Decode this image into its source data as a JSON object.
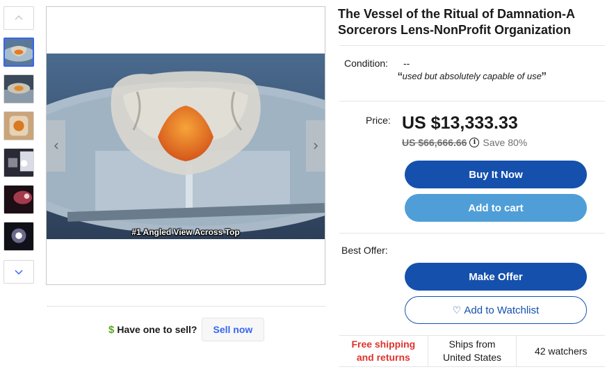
{
  "title": "The Vessel of the Ritual of Damnation-A Sorcerors Lens-NonProfit Organization",
  "gallery": {
    "caption": "#1 Angled View Across Top",
    "thumbnails": [
      "thumb-1",
      "thumb-2",
      "thumb-3",
      "thumb-4",
      "thumb-5",
      "thumb-6"
    ],
    "active_index": 0,
    "icons": {
      "up": "chevron-up-icon",
      "down": "chevron-down-icon",
      "prev": "chevron-left-icon",
      "next": "chevron-right-icon"
    }
  },
  "sell": {
    "icon": "dollar-icon",
    "icon_glyph": "$",
    "text": "Have one to sell?",
    "button": "Sell now"
  },
  "condition": {
    "label": "Condition:",
    "value": "--",
    "quote_open": "“",
    "note": "used but absolutely capable of use",
    "quote_close": "”"
  },
  "price": {
    "label": "Price:",
    "value": "US $13,333.33",
    "original": "US $66,666.66",
    "info_glyph": "i",
    "save": "Save 80%"
  },
  "buttons": {
    "buy_now": "Buy It Now",
    "add_to_cart": "Add to cart",
    "make_offer": "Make Offer",
    "watchlist": "Add to Watchlist",
    "heart_glyph": "♡"
  },
  "best_offer": {
    "label": "Best Offer:"
  },
  "info": {
    "shipping_line1": "Free shipping",
    "shipping_line2": "and returns",
    "ships_from_line1": "Ships from",
    "ships_from_line2": "United States",
    "watchers": "42 watchers"
  },
  "colors": {
    "primary": "#1550ad",
    "secondary": "#4f9ed8",
    "link": "#3665f3",
    "shipping": "#e0322d",
    "dollar": "#5ba71b"
  }
}
